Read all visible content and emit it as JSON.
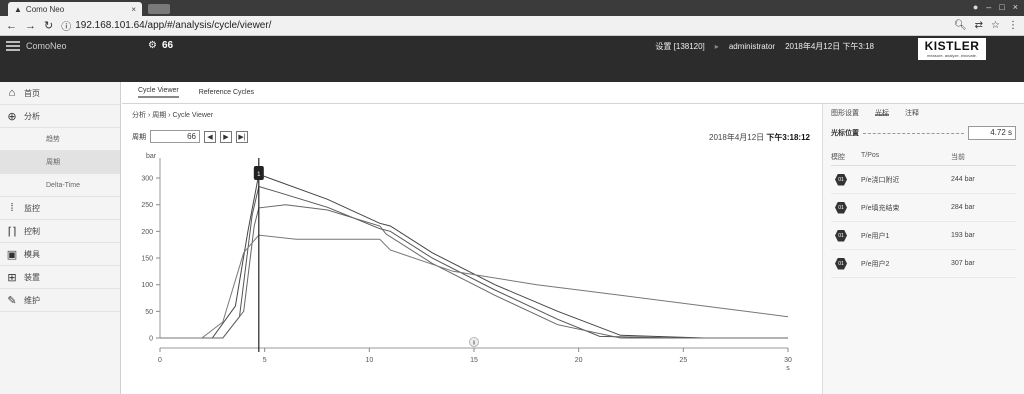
{
  "browser": {
    "tab_title": "Como Neo",
    "tab_close": "×",
    "url": "192.168.101.64/app/#/analysis/cycle/viewer/"
  },
  "app": {
    "name": "ComoNeo",
    "machine_num": "66",
    "settings_label": "设置 [138120]",
    "user": "administrator",
    "datetime": "2018年4月12日 下午3:18",
    "brand": "KISTLER",
    "brand_tagline": "measure. analyze. innovate."
  },
  "sidebar": {
    "items": [
      {
        "label": "首页",
        "icon": "home-icon"
      },
      {
        "label": "分析",
        "icon": "analysis-icon"
      },
      {
        "label": "趋势",
        "sub": true
      },
      {
        "label": "周期",
        "sub": true,
        "active": true
      },
      {
        "label": "Delta-Time",
        "sub": true
      },
      {
        "label": "监控",
        "icon": "monitor-icon"
      },
      {
        "label": "控制",
        "icon": "control-icon"
      },
      {
        "label": "模具",
        "icon": "mold-icon"
      },
      {
        "label": "装置",
        "icon": "device-icon"
      },
      {
        "label": "维护",
        "icon": "maintenance-icon"
      }
    ]
  },
  "subtabs": [
    "Cycle Viewer",
    "Reference Cycles"
  ],
  "main": {
    "breadcrumb": "分析 › 周期 › Cycle Viewer",
    "period_label": "周期",
    "period_value": "66",
    "btn_prev": "◀",
    "btn_next": "▶",
    "btn_last": "▶|",
    "date_prefix": "2018年4月12日",
    "date_time": "下午3:18:12"
  },
  "rpanel": {
    "tabs": [
      "图形设置",
      "光标",
      "注释"
    ],
    "cursor_label": "光标位置",
    "cursor_value": "4.72 s",
    "headers": [
      "模腔",
      "T/Pos",
      "当前"
    ],
    "rows": [
      {
        "badge": "01",
        "name": "P/e浇口附近",
        "value": "244 bar"
      },
      {
        "badge": "01",
        "name": "P/e填充结束",
        "value": "284 bar"
      },
      {
        "badge": "01",
        "name": "P/e用户1",
        "value": "193 bar"
      },
      {
        "badge": "01",
        "name": "P/e用户2",
        "value": "307 bar"
      }
    ]
  },
  "chart_data": {
    "type": "line",
    "ylabel": "bar",
    "xlabel": "s",
    "xlim": [
      0,
      30
    ],
    "ylim": [
      0,
      330
    ],
    "xticks": [
      0,
      5,
      10,
      15,
      20,
      25,
      30
    ],
    "yticks": [
      0,
      50,
      100,
      150,
      200,
      250,
      300
    ],
    "cursor_x": 4.72,
    "cursor_label": "1",
    "bottom_marker_label": "II",
    "series": [
      {
        "x": [
          0,
          2.5,
          3.6,
          4.2,
          4.72,
          5.2,
          8,
          10.5,
          11,
          13,
          16,
          19,
          22,
          26,
          30
        ],
        "y": [
          0,
          0,
          60,
          200,
          307,
          300,
          260,
          215,
          210,
          160,
          100,
          50,
          5,
          0,
          0
        ]
      },
      {
        "x": [
          0,
          3,
          3.8,
          4.4,
          4.72,
          5.5,
          8,
          10.5,
          11,
          13,
          16,
          19,
          21,
          25,
          30
        ],
        "y": [
          0,
          0,
          40,
          230,
          284,
          275,
          245,
          205,
          200,
          150,
          90,
          35,
          3,
          0,
          0
        ]
      },
      {
        "x": [
          0,
          3,
          4,
          4.5,
          4.72,
          6,
          8,
          10.5,
          10.8,
          13,
          16,
          19,
          22,
          27,
          30
        ],
        "y": [
          0,
          0,
          50,
          210,
          244,
          250,
          240,
          210,
          195,
          140,
          80,
          25,
          0,
          0,
          0
        ]
      },
      {
        "x": [
          0,
          2,
          3,
          4,
          4.72,
          6.5,
          10.5,
          11,
          14,
          18,
          22,
          26,
          30
        ],
        "y": [
          0,
          0,
          30,
          160,
          193,
          185,
          185,
          165,
          125,
          100,
          80,
          60,
          40
        ]
      }
    ]
  }
}
